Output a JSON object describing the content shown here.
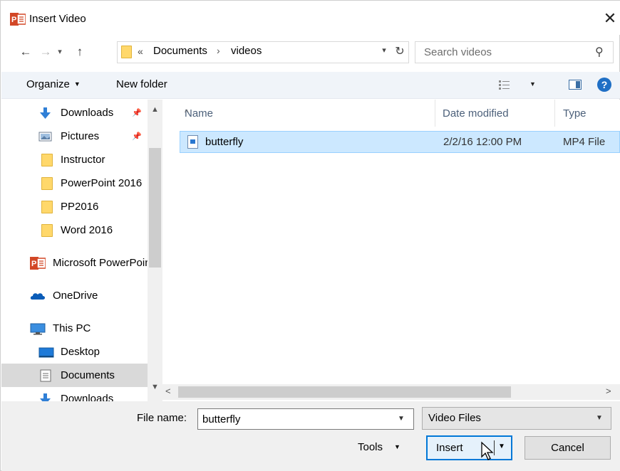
{
  "window": {
    "title": "Insert Video",
    "close_glyph": "✕"
  },
  "address": {
    "overflow_glyph": "«",
    "crumbs": [
      "Documents",
      "videos"
    ],
    "separator": "›"
  },
  "search": {
    "placeholder": "Search videos"
  },
  "commandbar": {
    "organize_label": "Organize",
    "new_folder_label": "New folder",
    "help_glyph": "?"
  },
  "nav": {
    "items": [
      {
        "label": "Downloads",
        "icon": "download-arrow-icon",
        "pinned": true
      },
      {
        "label": "Pictures",
        "icon": "pictures-icon",
        "pinned": true
      },
      {
        "label": "Instructor",
        "icon": "folder-icon"
      },
      {
        "label": "PowerPoint 2016",
        "icon": "folder-icon"
      },
      {
        "label": "PP2016",
        "icon": "folder-icon"
      },
      {
        "label": "Word 2016",
        "icon": "folder-icon"
      },
      {
        "label": "Microsoft PowerPoint",
        "icon": "powerpoint-icon"
      },
      {
        "label": "OneDrive",
        "icon": "onedrive-cloud-icon"
      },
      {
        "label": "This PC",
        "icon": "computer-icon"
      },
      {
        "label": "Desktop",
        "icon": "desktop-icon"
      },
      {
        "label": "Documents",
        "icon": "documents-icon",
        "selected": true
      },
      {
        "label": "Downloads",
        "icon": "download-arrow-icon"
      }
    ]
  },
  "filelist": {
    "columns": {
      "name": "Name",
      "date": "Date modified",
      "type": "Type"
    },
    "files": [
      {
        "name": "butterfly",
        "date": "2/2/16 12:00 PM",
        "type": "MP4 File",
        "selected": true
      }
    ]
  },
  "bottom": {
    "file_name_label": "File name:",
    "file_name_value": "butterfly",
    "filter_value": "Video Files",
    "tools_label": "Tools",
    "insert_label": "Insert",
    "cancel_label": "Cancel"
  },
  "colors": {
    "accent": "#0078d7",
    "selection_fill": "#cce8ff",
    "selection_border": "#99d1ff",
    "commandbar_bg": "#f0f4f9",
    "powerpoint": "#d24726"
  }
}
